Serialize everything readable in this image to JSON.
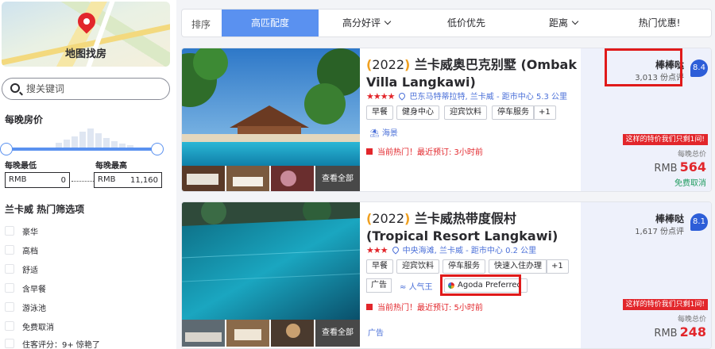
{
  "sidebar": {
    "map_label": "地图找房",
    "search_placeholder": "搜关键词",
    "price_title": "每晚房价",
    "min_label": "每晚最低",
    "max_label": "每晚最高",
    "currency": "RMB",
    "min_value": "0",
    "max_value": "11,160",
    "filter_title": "兰卡威 热门筛选项",
    "filters": [
      "豪华",
      "高档",
      "舒适",
      "含早餐",
      "游泳池",
      "免费取消",
      "住客评分：9+ 惊艳了"
    ]
  },
  "sortbar": {
    "label": "排序",
    "tabs": [
      "高匹配度",
      "高分好评",
      "低价优先",
      "距离",
      "热门优惠!"
    ],
    "active_tab": "高匹配度"
  },
  "hotels": [
    {
      "year": "2022",
      "name": "兰卡威奥巴克别墅 (Ombak Villa Langkawi)",
      "stars": 4,
      "location": "巴东马特蒂拉特, 兰卡威 - 距市中心 5.3 公里",
      "tags": [
        "早餐",
        "健身中心",
        "迎宾饮料",
        "停车服务",
        "+1"
      ],
      "feature": "海景",
      "hot_text": "当前热门！最近预订: 3小时前",
      "view_all": "查看全部",
      "review_word": "棒棒哒",
      "review_count": "3,013 份点评",
      "score": "8.4",
      "deal_text": "这样的特价我们只剩1间!",
      "per_night": "每晚总价",
      "currency": "RMB",
      "price": "564",
      "free_cancel": "免费取消"
    },
    {
      "year": "2022",
      "name": "兰卡威热带度假村 (Tropical Resort Langkawi)",
      "stars": 3,
      "location": "中央海滩, 兰卡威 - 距市中心 0.2 公里",
      "tags": [
        "早餐",
        "迎宾饮料",
        "停车服务",
        "快速入住办理",
        "+1"
      ],
      "ad_label": "广告",
      "popular_label": "人气王",
      "agoda_label": "Agoda Preferred",
      "hot_text": "当前热门！最近预订: 5小时前",
      "ad_footer": "广告",
      "view_all": "查看全部",
      "review_word": "棒棒哒",
      "review_count": "1,617 份点评",
      "score": "8.1",
      "deal_text": "这样的特价我们只剩1间!",
      "per_night": "每晚总价",
      "currency": "RMB",
      "price": "248"
    }
  ],
  "colors": {
    "accent": "#5a91f0",
    "price_red": "#e2262b",
    "score_blue": "#2d5ed8",
    "highlight_red": "#e01a1a"
  }
}
